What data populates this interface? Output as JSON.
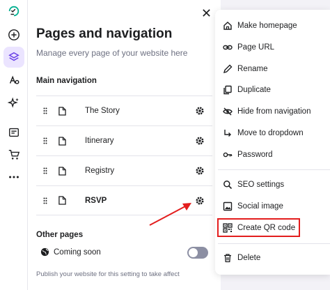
{
  "panel": {
    "title": "Pages and navigation",
    "subtitle": "Manage every page of your website here",
    "main_nav_label": "Main navigation",
    "other_pages_label": "Other pages",
    "pages": [
      {
        "label": "The Story"
      },
      {
        "label": "Itinerary"
      },
      {
        "label": "Registry"
      },
      {
        "label": "RSVP"
      }
    ],
    "coming_soon_label": "Coming soon",
    "coming_soon_enabled": false,
    "publish_hint": "Publish your website for this setting to take affect"
  },
  "menu": {
    "items": [
      {
        "label": "Make homepage",
        "icon": "home-icon"
      },
      {
        "label": "Page URL",
        "icon": "link-icon"
      },
      {
        "label": "Rename",
        "icon": "pencil-icon"
      },
      {
        "label": "Duplicate",
        "icon": "duplicate-icon"
      },
      {
        "label": "Hide from navigation",
        "icon": "eye-off-icon"
      },
      {
        "label": "Move to dropdown",
        "icon": "arrow-turn-icon"
      },
      {
        "label": "Password",
        "icon": "key-icon"
      },
      {
        "label": "SEO settings",
        "icon": "search-icon"
      },
      {
        "label": "Social image",
        "icon": "image-icon"
      },
      {
        "label": "Create QR code",
        "icon": "qr-code-icon"
      },
      {
        "label": "Delete",
        "icon": "trash-icon"
      }
    ]
  },
  "colors": {
    "accent": "#673de6",
    "highlight": "#e31d1d",
    "active_rail_bg": "#ebe4ff"
  }
}
